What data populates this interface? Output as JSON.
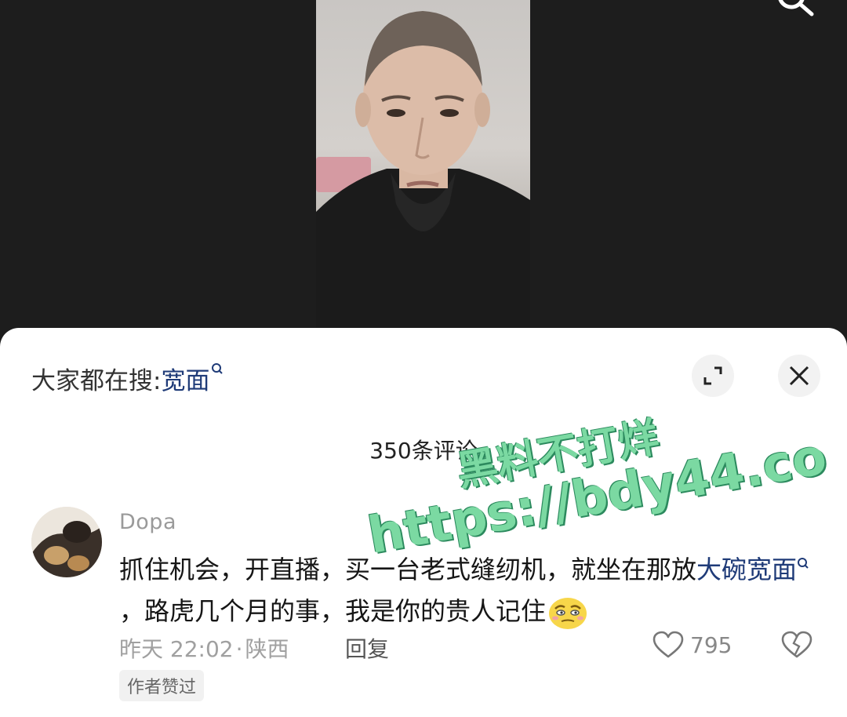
{
  "video": {
    "icons": [
      "search-icon"
    ]
  },
  "sheet": {
    "hot_search_prefix": "大家都在搜:",
    "hot_search_term": "宽面",
    "comment_count_label": "350条评论",
    "icons": [
      "expand-icon",
      "close-icon"
    ]
  },
  "comment": {
    "username": "Dopa",
    "text_part1": "抓住机会，开直播，买一台老式缝纫机，就坐在那放",
    "text_link": "大碗宽面",
    "text_part2": "，路虎几个月的事，我是你的贵人记住",
    "emoji": "smug-face-emoji",
    "time": "昨天 22:02",
    "location": "陕西",
    "reply_label": "回复",
    "like_count": "795",
    "author_liked_badge": "作者赞过",
    "icons": [
      "heart-icon",
      "broken-heart-icon"
    ]
  },
  "watermark": {
    "line1": "黑料不打烊",
    "line2": "https://bdy44.co"
  },
  "colors": {
    "link": "#1f3b78",
    "watermark": "#7bd9a2",
    "muted": "#a0a0a0"
  }
}
